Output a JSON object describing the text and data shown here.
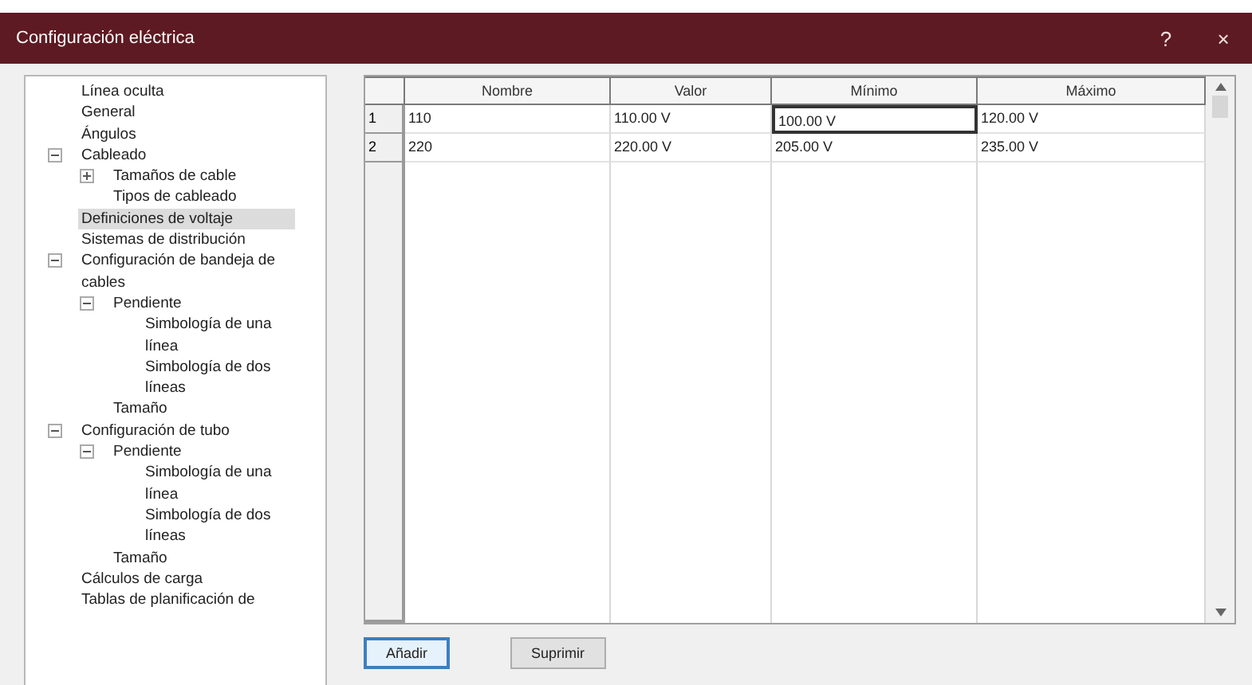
{
  "window": {
    "title": "Configuración eléctrica",
    "help": "?",
    "close": "×"
  },
  "tree": [
    {
      "label": "Línea oculta",
      "selected": false
    },
    {
      "label": "General",
      "selected": false
    },
    {
      "label": "Ángulos",
      "selected": false
    },
    {
      "label": "Cableado",
      "selected": false,
      "expanded": true,
      "children": [
        {
          "label": "Tamaños de cable",
          "selected": false,
          "expanded": false
        },
        {
          "label": "Tipos de cableado",
          "selected": false
        }
      ]
    },
    {
      "label": "Definiciones de voltaje",
      "selected": true
    },
    {
      "label": "Sistemas de distribución",
      "selected": false
    },
    {
      "label": "Configuración de bandeja de cables",
      "selected": false,
      "expanded": true,
      "children": [
        {
          "label": "Pendiente",
          "selected": false,
          "expanded": true,
          "children": [
            {
              "label": "Simbología de una línea",
              "selected": false
            },
            {
              "label": "Simbología de dos líneas",
              "selected": false
            }
          ]
        },
        {
          "label": "Tamaño",
          "selected": false
        }
      ]
    },
    {
      "label": "Configuración de tubo",
      "selected": false,
      "expanded": true,
      "children": [
        {
          "label": "Pendiente",
          "selected": false,
          "expanded": true,
          "children": [
            {
              "label": "Simbología de una línea",
              "selected": false
            },
            {
              "label": "Simbología de dos líneas",
              "selected": false
            }
          ]
        },
        {
          "label": "Tamaño",
          "selected": false
        }
      ]
    },
    {
      "label": "Cálculos de carga",
      "selected": false
    },
    {
      "label": "Tablas de planificación de",
      "selected": false
    }
  ],
  "table": {
    "columns": [
      "Nombre",
      "Valor",
      "Mínimo",
      "Máximo"
    ],
    "rows": [
      {
        "number": "1",
        "cells": [
          {
            "text": "110",
            "focused": false
          },
          {
            "text": "110.00 V",
            "focused": false
          },
          {
            "text": "100.00 V",
            "focused": true
          },
          {
            "text": "120.00 V",
            "focused": false
          }
        ]
      },
      {
        "number": "2",
        "cells": [
          {
            "text": "220",
            "focused": false
          },
          {
            "text": "220.00 V",
            "focused": false
          },
          {
            "text": "205.00 V",
            "focused": false
          },
          {
            "text": "235.00 V",
            "focused": false
          }
        ]
      }
    ]
  },
  "buttons": [
    {
      "label": "Añadir",
      "default": true
    },
    {
      "label": "Suprimir",
      "default": false
    }
  ]
}
